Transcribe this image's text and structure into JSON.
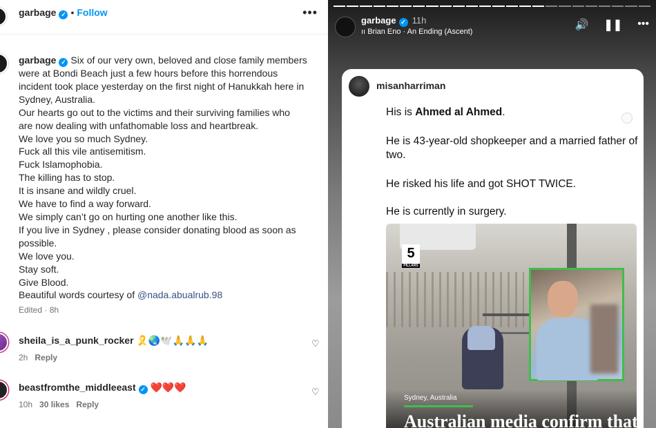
{
  "post": {
    "username": "garbage",
    "follow": "Follow",
    "more": "•••"
  },
  "caption": {
    "username": "garbage",
    "lines": [
      "Six of our very own, beloved and close family members",
      "were at Bondi Beach just a few hours before this horrendous",
      "incident took place yesterday on the first night of Hanukkah here in",
      "Sydney, Australia.",
      "Our hearts go out to the victims and their surviving families who",
      "are now dealing with unfathomable loss and heartbreak.",
      "We love you so much Sydney.",
      "Fuck all this vile antisemitism.",
      "Fuck Islamophobia.",
      "The killing has to stop.",
      "It is insane and wildly cruel.",
      "We have to find a way forward.",
      "We simply can’t go on hurting one another like this.",
      "If you live in Sydney , please consider donating blood as soon as",
      "possible.",
      "We love you.",
      "Stay soft.",
      "Give Blood.",
      "Beautiful words courtesy of"
    ],
    "mention": "@nada.abualrub.98",
    "edited": "Edited · 8h"
  },
  "comments": [
    {
      "username": "sheila_is_a_punk_rocker",
      "emojis": "🎗️🌏🕊️🙏🙏🙏",
      "time": "2h",
      "likes": "",
      "reply": "Reply"
    },
    {
      "username": "beastfromthe_middleeast",
      "emojis": "❤️❤️❤️",
      "time": "10h",
      "likes": "30 likes",
      "reply": "Reply"
    }
  ],
  "story": {
    "username": "garbage",
    "time": "11h",
    "music": "Brian Eno · An Ending (Ascent)",
    "card": {
      "username": "misanharriman",
      "line1_pre": "His is ",
      "line1_bold": "Ahmed al Ahmed",
      "line1_post": ".",
      "line2": "He is 43-year-old shopkeeper and a married father of two.",
      "line3": "He risked his life and got SHOT TWICE.",
      "line4": "He is currently in surgery."
    },
    "news": {
      "logo_number": "5",
      "logo_sub": "PILLARS",
      "location": "Sydney, Australia",
      "headline": "Australian media confirm that"
    }
  },
  "colors": {
    "link": "#0095f6",
    "verified": "#0095f6",
    "accent_green": "#3fbe4a"
  }
}
